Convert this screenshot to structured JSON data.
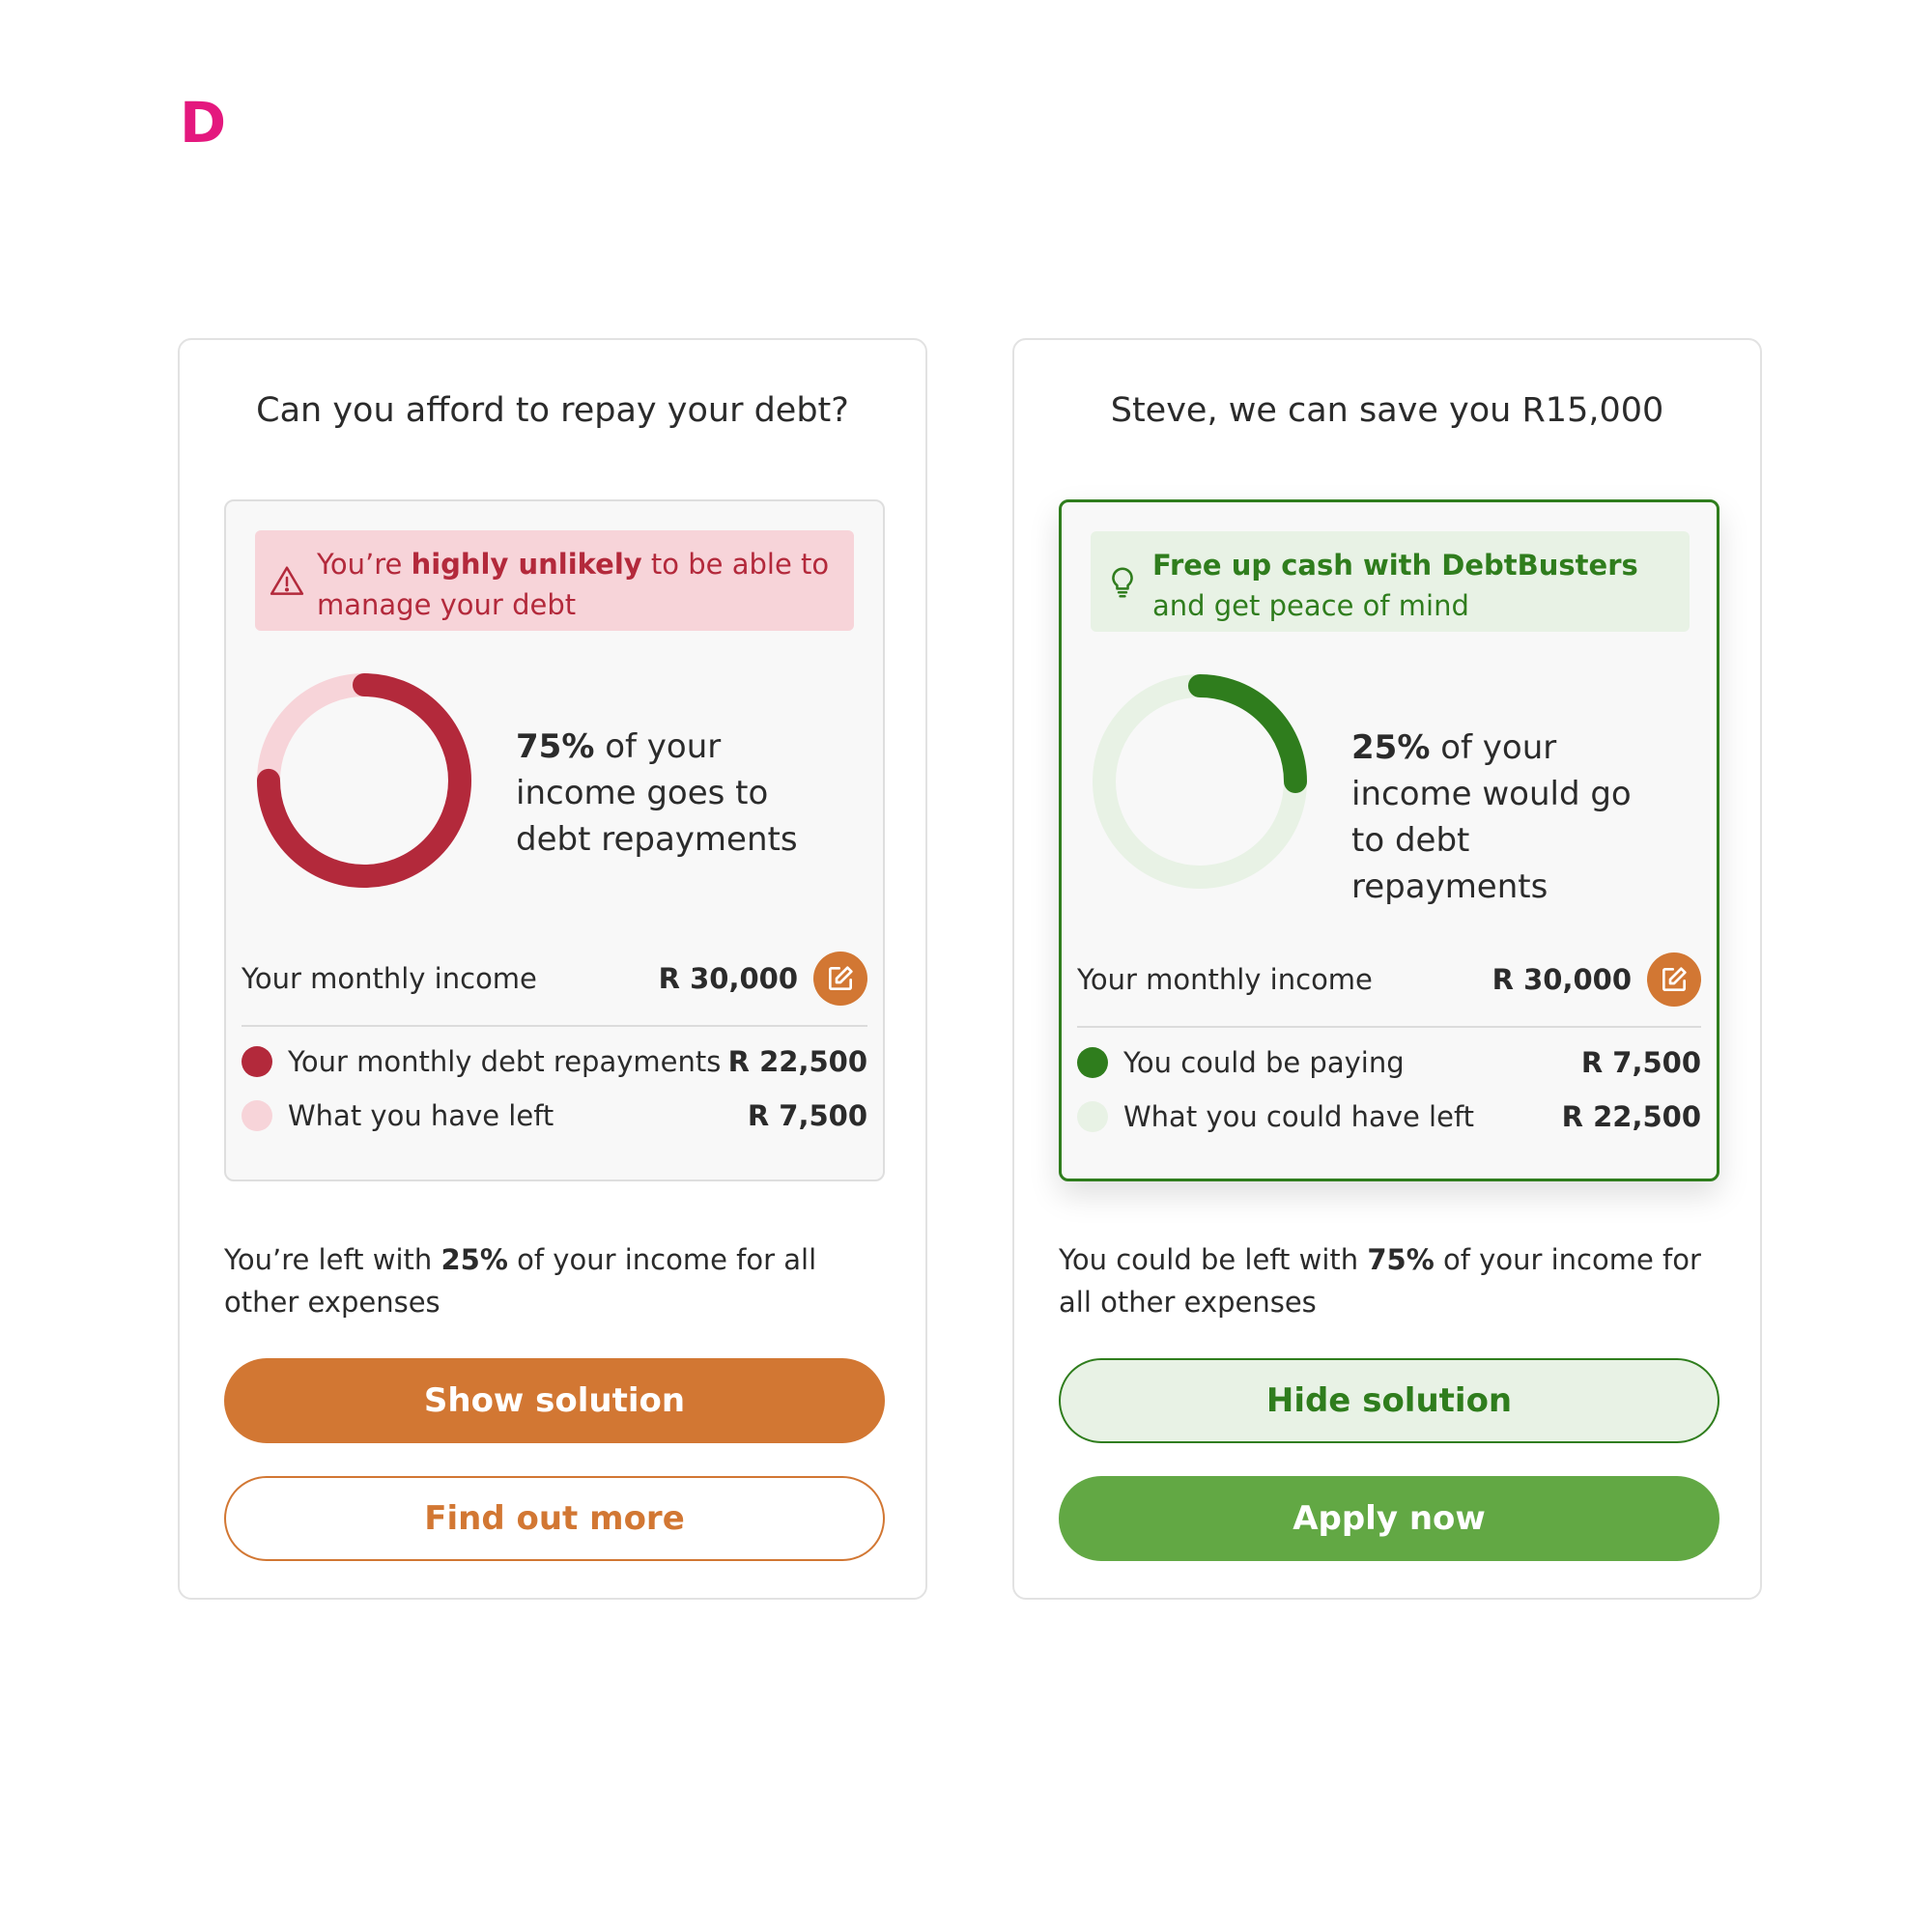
{
  "brand": {
    "logo_letter": "D",
    "color": "#e4187e"
  },
  "colors": {
    "danger": "#b3293b",
    "danger_light": "#f7d4d9",
    "accent_orange": "#d27733",
    "success": "#2f7d1d",
    "success_light": "#e8f2e5",
    "success_button": "#62a844"
  },
  "left_card": {
    "title": "Can you afford to repay your debt?",
    "banner": {
      "icon": "warning-triangle-icon",
      "prefix": "You’re ",
      "bold": "highly unlikely",
      "suffix": " to be able to manage your debt"
    },
    "donut": {
      "filled_fraction": 0.75,
      "fill_color": "#b3293b",
      "track_color": "#f7d4d9"
    },
    "stat": {
      "bold": "75%",
      "text": " of your income goes to debt repayments"
    },
    "income": {
      "label": "Your monthly income",
      "value": "R 30,000",
      "edit_icon": "edit-icon"
    },
    "rows": [
      {
        "label": "Your monthly debt repayments",
        "value": "R 22,500",
        "dot_color": "#b3293b"
      },
      {
        "label": "What you have left",
        "value": "R 7,500",
        "dot_color": "#f7d4d9"
      }
    ],
    "summary": {
      "prefix": "You’re left with ",
      "bold": "25%",
      "suffix": " of your income for all other expenses"
    },
    "primary_button": "Show solution",
    "secondary_button": "Find out more"
  },
  "right_card": {
    "title": "Steve, we can save you R15,000",
    "banner": {
      "icon": "lightbulb-icon",
      "bold": "Free up cash with DebtBusters",
      "suffix": " and get peace of mind"
    },
    "donut": {
      "filled_fraction": 0.25,
      "fill_color": "#2f7d1d",
      "track_color": "#e8f2e5"
    },
    "stat": {
      "bold": "25%",
      "text": " of your income would go to debt repayments"
    },
    "income": {
      "label": "Your monthly income",
      "value": "R 30,000",
      "edit_icon": "edit-icon"
    },
    "rows": [
      {
        "label": "You could be paying",
        "value": "R 7,500",
        "dot_color": "#2f7d1d"
      },
      {
        "label": "What you could have left",
        "value": "R 22,500",
        "dot_color": "#e8f2e5"
      }
    ],
    "summary": {
      "prefix": "You could be left with ",
      "bold": "75%",
      "suffix": " of your income for all other expenses"
    },
    "primary_button": "Hide solution",
    "secondary_button": "Apply now"
  }
}
